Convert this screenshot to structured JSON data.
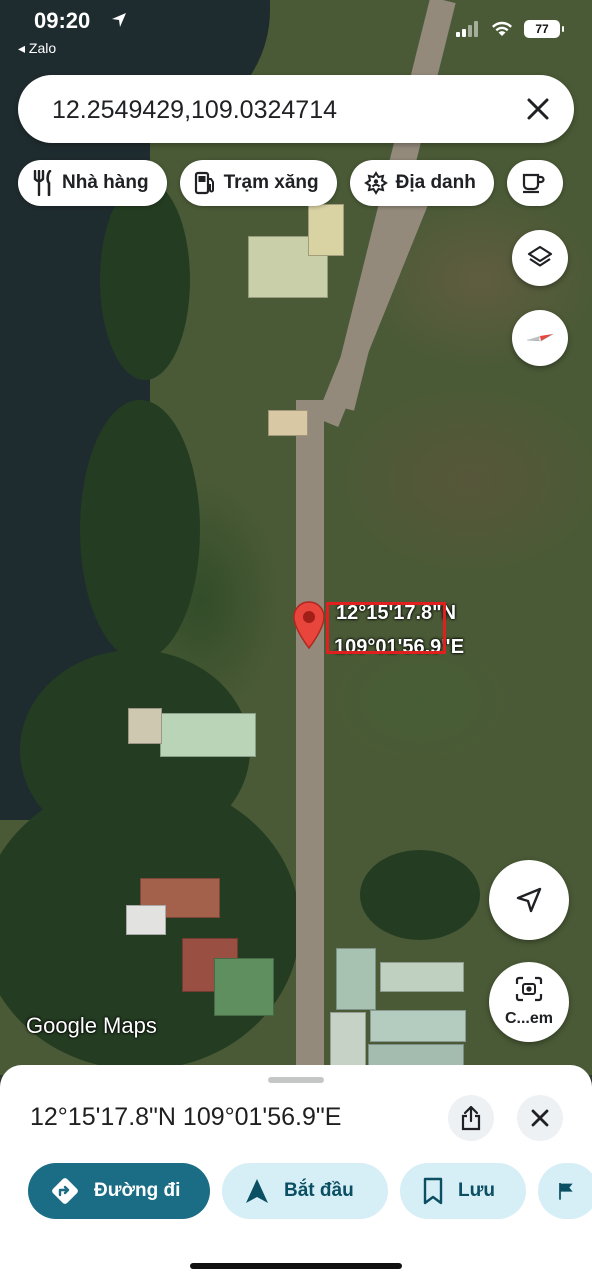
{
  "status_bar": {
    "time": "09:20",
    "back_app": "◂ Zalo",
    "battery": "77"
  },
  "search": {
    "query": "12.2549429,109.0324714",
    "clear_icon": "close-icon"
  },
  "category_chips": [
    {
      "label": "Nhà hàng",
      "icon": "fork-knife-icon"
    },
    {
      "label": "Trạm xăng",
      "icon": "gas-station-icon"
    },
    {
      "label": "Địa danh",
      "icon": "landmark-icon"
    },
    {
      "label": "",
      "icon": "coffee-icon"
    }
  ],
  "map": {
    "pin_label_line1": "12°15'17.8\"N",
    "pin_label_line2": "109°01'56.9\"E",
    "watermark": "Google Maps",
    "lens_label": "C...em",
    "pin_color": "#e8453c",
    "highlight_color": "#e0201f"
  },
  "place_sheet": {
    "title": "12°15'17.8\"N 109°01'56.9\"E",
    "actions": [
      {
        "label": "Đường đi",
        "icon": "directions-icon"
      },
      {
        "label": "Bắt đầu",
        "icon": "navigation-icon"
      },
      {
        "label": "Lưu",
        "icon": "bookmark-icon"
      },
      {
        "label": "",
        "icon": "flag-icon"
      }
    ]
  },
  "colors": {
    "primary_action": "#1a6d84",
    "secondary_action": "#d6eef6"
  }
}
